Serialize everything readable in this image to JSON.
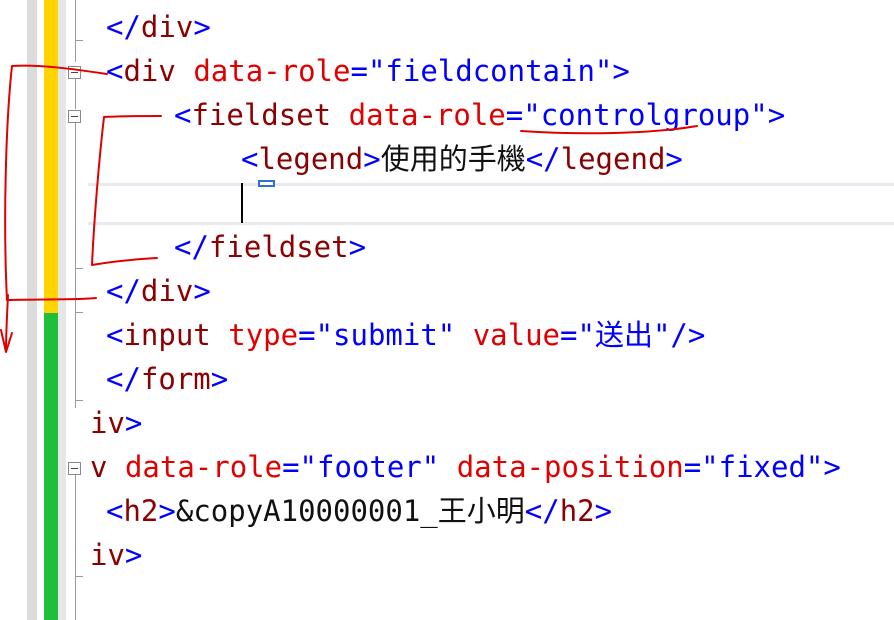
{
  "editor": {
    "lines": [
      {
        "id": "div-close-1",
        "indent": "",
        "open": "</",
        "tag": "div",
        "close": ">"
      },
      {
        "id": "div-fieldcontain",
        "open": "<",
        "tag": "div",
        "attr1": "data-role",
        "eq1": "=",
        "val1": "\"fieldcontain\"",
        "close": ">"
      },
      {
        "id": "fieldset-open",
        "open": "<",
        "tag": "fieldset",
        "attr1": "data-role",
        "eq1": "=",
        "val1a": "\"",
        "val1b": "controlgroup",
        "val1c": "\"",
        "close": ">"
      },
      {
        "id": "legend",
        "open": "<",
        "tag": "legend",
        "close": ">",
        "text": "使用的手機",
        "open2": "</",
        "tag2": "legend",
        "close2": ">"
      },
      {
        "id": "fieldset-close",
        "open": "</",
        "tag": "fieldset",
        "close": ">"
      },
      {
        "id": "div-close-2",
        "open": "</",
        "tag": "div",
        "close": ">"
      },
      {
        "id": "input-submit",
        "open": "<",
        "tag": "input",
        "attr1": "type",
        "eq1": "=",
        "val1": "\"submit\"",
        "attr2": "value",
        "eq2": "=",
        "val2": "\"送出\"",
        "close": "/>"
      },
      {
        "id": "form-close",
        "open": "</",
        "tag": "form",
        "close": ">"
      },
      {
        "id": "iv-close-1",
        "tag": "iv",
        "close": ">"
      },
      {
        "id": "footer-div",
        "tag": "v",
        "attr1": "data-role",
        "eq1": "=",
        "val1": "\"footer\"",
        "attr2": "data-position",
        "eq2": "=",
        "val2": "\"fixed\"",
        "close": ">"
      },
      {
        "id": "h2",
        "open": "<",
        "tag": "h2",
        "close": ">",
        "text": "&copyA10000001_王小明",
        "open2": "</",
        "tag2": "h2",
        "close2": ">"
      },
      {
        "id": "iv-close-2",
        "tag": "iv",
        "close": ">"
      }
    ]
  },
  "colors": {
    "tag": "#8b0000",
    "attribute": "#e00000",
    "value": "#0000ff",
    "delimiter": "#0000ff",
    "text": "#111111",
    "change_bar_modified": "#ffd400",
    "change_bar_saved": "#1fbf3a",
    "annotation_ink": "#e00000"
  }
}
